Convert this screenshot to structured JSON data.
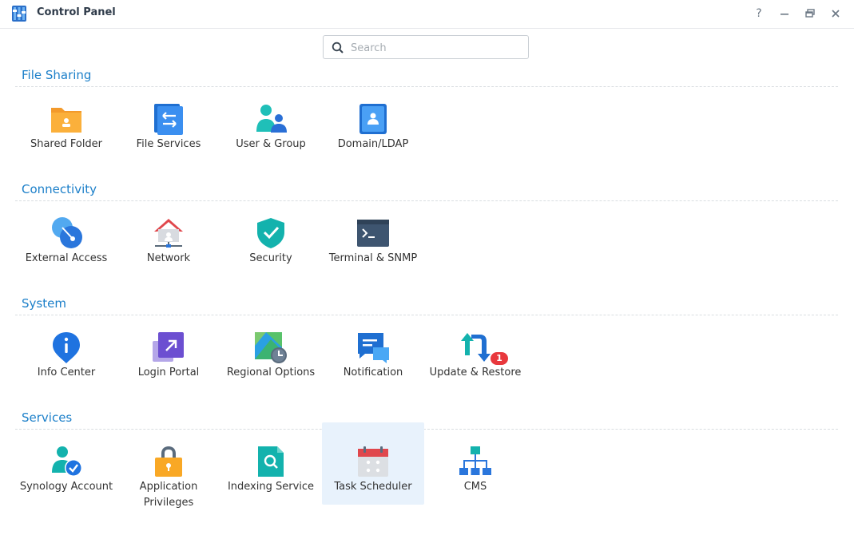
{
  "window": {
    "title": "Control Panel"
  },
  "titlebar_buttons": [
    {
      "name": "help-button",
      "icon": "help-icon",
      "glyph": "?"
    },
    {
      "name": "minimize-button",
      "icon": "minimize-icon",
      "glyph": "—"
    },
    {
      "name": "restore-button",
      "icon": "restore-icon",
      "glyph": ""
    },
    {
      "name": "close-button",
      "icon": "close-icon",
      "glyph": "✕"
    }
  ],
  "search": {
    "placeholder": "Search",
    "value": ""
  },
  "sections": [
    {
      "title": "File Sharing",
      "items": [
        {
          "label": "Shared Folder",
          "icon": "shared-folder-icon"
        },
        {
          "label": "File Services",
          "icon": "file-services-icon"
        },
        {
          "label": "User & Group",
          "icon": "user-group-icon"
        },
        {
          "label": "Domain/LDAP",
          "icon": "domain-ldap-icon"
        }
      ]
    },
    {
      "title": "Connectivity",
      "items": [
        {
          "label": "External Access",
          "icon": "external-access-icon"
        },
        {
          "label": "Network",
          "icon": "network-icon"
        },
        {
          "label": "Security",
          "icon": "security-icon"
        },
        {
          "label": "Terminal & SNMP",
          "icon": "terminal-icon"
        }
      ]
    },
    {
      "title": "System",
      "items": [
        {
          "label": "Info Center",
          "icon": "info-center-icon"
        },
        {
          "label": "Login Portal",
          "icon": "login-portal-icon"
        },
        {
          "label": "Regional Options",
          "icon": "regional-options-icon"
        },
        {
          "label": "Notification",
          "icon": "notification-icon"
        },
        {
          "label": "Update & Restore",
          "icon": "update-restore-icon",
          "badge": "1"
        }
      ]
    },
    {
      "title": "Services",
      "items": [
        {
          "label": "Synology Account",
          "icon": "synology-account-icon"
        },
        {
          "label": "Application Privileges",
          "icon": "application-privileges-icon"
        },
        {
          "label": "Indexing Service",
          "icon": "indexing-service-icon"
        },
        {
          "label": "Task Scheduler",
          "icon": "task-scheduler-icon",
          "selected": true
        },
        {
          "label": "CMS",
          "icon": "cms-icon"
        }
      ]
    }
  ],
  "colors": {
    "accent": "#1b7fc9",
    "selected_bg": "#e8f2fc",
    "badge": "#e8383d"
  }
}
